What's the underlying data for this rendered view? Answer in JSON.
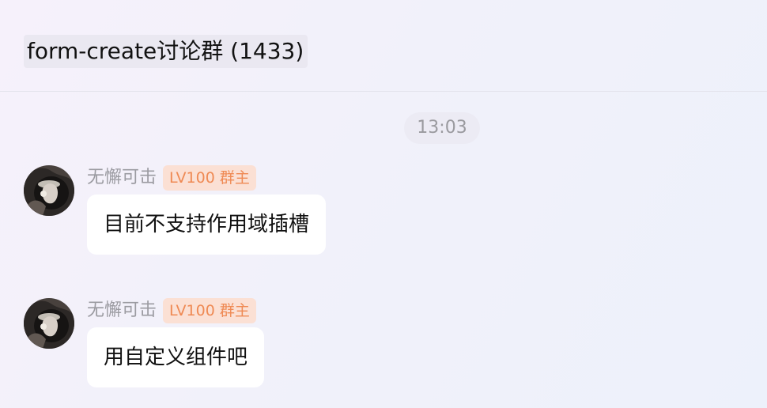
{
  "header": {
    "group_title": "form-create讨论群 (1433)"
  },
  "timestamp": "13:03",
  "messages": [
    {
      "sender": "无懈可击",
      "badge": "LV100 群主",
      "text": "目前不支持作用域插槽"
    },
    {
      "sender": "无懈可击",
      "badge": "LV100 群主",
      "text": "用自定义组件吧"
    }
  ],
  "colors": {
    "badge_background": "#fbe0d4",
    "badge_text": "#ef8a54",
    "bubble_background": "#ffffff",
    "muted_text": "#9b9ba1"
  }
}
